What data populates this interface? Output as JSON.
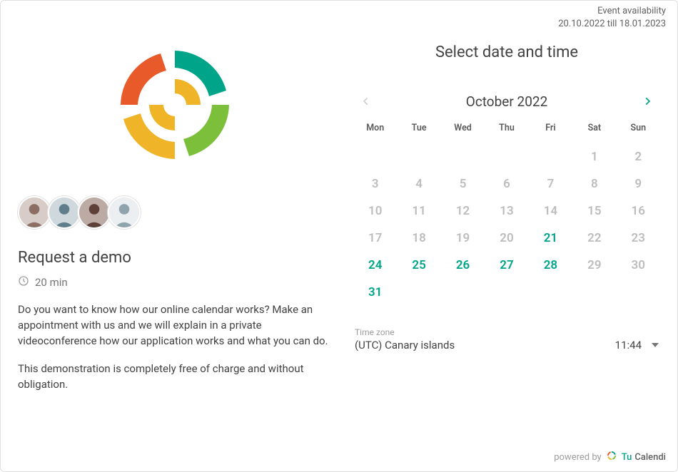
{
  "availability": {
    "label": "Event availability",
    "range": "20.10.2022 till 18.01.2023"
  },
  "event": {
    "title": "Request a demo",
    "duration": "20 min",
    "description_p1": "Do you want to know how our online calendar works? Make an appointment with us and we will explain in a private videoconference how our application works and what you can do.",
    "description_p2": "This demonstration is completely free of charge and without obligation."
  },
  "avatars": [
    "team-member-1",
    "team-member-2",
    "team-member-3",
    "team-member-4"
  ],
  "picker": {
    "heading": "Select date and time",
    "month_label": "October 2022",
    "prev_enabled": false,
    "next_enabled": true,
    "dow": [
      "Mon",
      "Tue",
      "Wed",
      "Thu",
      "Fri",
      "Sat",
      "Sun"
    ],
    "weeks": [
      [
        {
          "n": "",
          "available": false
        },
        {
          "n": "",
          "available": false
        },
        {
          "n": "",
          "available": false
        },
        {
          "n": "",
          "available": false
        },
        {
          "n": "",
          "available": false
        },
        {
          "n": "1",
          "available": false
        },
        {
          "n": "2",
          "available": false
        }
      ],
      [
        {
          "n": "3",
          "available": false
        },
        {
          "n": "4",
          "available": false
        },
        {
          "n": "5",
          "available": false
        },
        {
          "n": "6",
          "available": false
        },
        {
          "n": "7",
          "available": false
        },
        {
          "n": "8",
          "available": false
        },
        {
          "n": "9",
          "available": false
        }
      ],
      [
        {
          "n": "10",
          "available": false
        },
        {
          "n": "11",
          "available": false
        },
        {
          "n": "12",
          "available": false
        },
        {
          "n": "13",
          "available": false
        },
        {
          "n": "14",
          "available": false
        },
        {
          "n": "15",
          "available": false
        },
        {
          "n": "16",
          "available": false
        }
      ],
      [
        {
          "n": "17",
          "available": false
        },
        {
          "n": "18",
          "available": false
        },
        {
          "n": "19",
          "available": false
        },
        {
          "n": "20",
          "available": false
        },
        {
          "n": "21",
          "available": true
        },
        {
          "n": "22",
          "available": false
        },
        {
          "n": "23",
          "available": false
        }
      ],
      [
        {
          "n": "24",
          "available": true
        },
        {
          "n": "25",
          "available": true
        },
        {
          "n": "26",
          "available": true
        },
        {
          "n": "27",
          "available": true
        },
        {
          "n": "28",
          "available": true
        },
        {
          "n": "29",
          "available": false
        },
        {
          "n": "30",
          "available": false
        }
      ],
      [
        {
          "n": "31",
          "available": true
        },
        {
          "n": "",
          "available": false
        },
        {
          "n": "",
          "available": false
        },
        {
          "n": "",
          "available": false
        },
        {
          "n": "",
          "available": false
        },
        {
          "n": "",
          "available": false
        },
        {
          "n": "",
          "available": false
        }
      ]
    ]
  },
  "timezone": {
    "label": "Time zone",
    "name": "(UTC) Canary islands",
    "time": "11:44"
  },
  "footer": {
    "powered_by": "powered by",
    "brand_tu": "Tu",
    "brand_calendi": "Calendi"
  },
  "colors": {
    "accent": "#00a589",
    "orange": "#e85a2a",
    "yellow": "#f0b428",
    "green": "#7bbf3a"
  }
}
